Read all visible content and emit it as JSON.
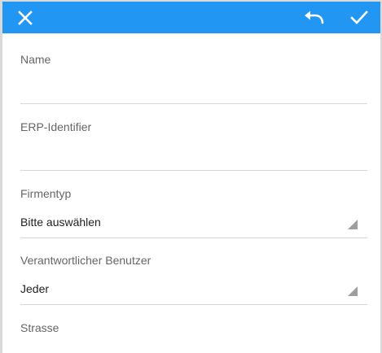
{
  "toolbar": {
    "accent_color": "#2196f3",
    "close_icon": "close-icon",
    "undo_icon": "undo-icon",
    "save_icon": "check-icon"
  },
  "form": {
    "name": {
      "label": "Name",
      "value": ""
    },
    "erp_identifier": {
      "label": "ERP-Identifier",
      "value": ""
    },
    "company_type": {
      "label": "Firmentyp",
      "selected": "Bitte auswählen"
    },
    "responsible_user": {
      "label": "Verantwortlicher Benutzer",
      "selected": "Jeder"
    },
    "street": {
      "label": "Strasse",
      "value": ""
    }
  }
}
